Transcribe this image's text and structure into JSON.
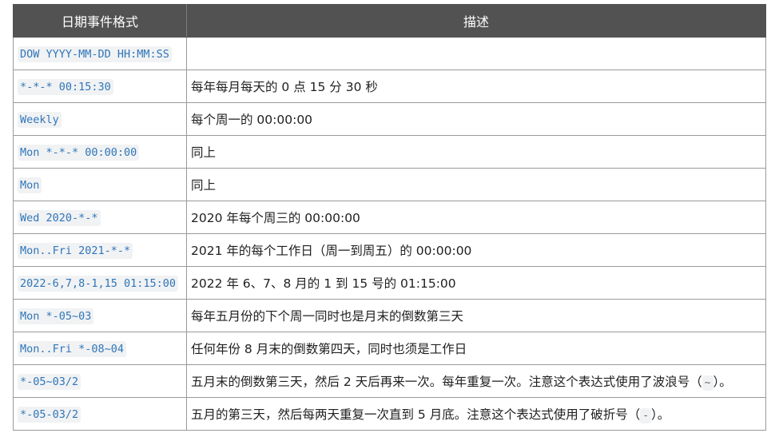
{
  "table": {
    "headers": [
      "日期事件格式",
      "描述"
    ],
    "rows": [
      {
        "format": "DOW YYYY-MM-DD HH:MM:SS",
        "desc": ""
      },
      {
        "format": "*-*-* 00:15:30",
        "desc": "每年每月每天的 0 点 15 分 30 秒"
      },
      {
        "format": "Weekly",
        "desc": "每个周一的 00:00:00"
      },
      {
        "format": "Mon *-*-* 00:00:00",
        "desc": "同上"
      },
      {
        "format": "Mon",
        "desc": "同上"
      },
      {
        "format": "Wed 2020-*-*",
        "desc": "2020 年每个周三的 00:00:00"
      },
      {
        "format": "Mon..Fri 2021-*-*",
        "desc": "2021 年的每个工作日（周一到周五）的 00:00:00"
      },
      {
        "format": "2022-6,7,8-1,15 01:15:00",
        "desc": "2022 年 6、7、8 月的 1 到 15 号的 01:15:00"
      },
      {
        "format": "Mon *-05~03",
        "desc": "每年五月份的下个周一同时也是月末的倒数第三天"
      },
      {
        "format": "Mon..Fri *-08~04",
        "desc": "任何年份 8 月末的倒数第四天，同时也须是工作日"
      },
      {
        "format": "*-05~03/2",
        "desc_before": "五月末的倒数第三天，然后 2 天后再来一次。每年重复一次。注意这个表达式使用了波浪号（",
        "desc_code": "~",
        "desc_after": "）。"
      },
      {
        "format": "*-05-03/2",
        "desc_before": "五月的第三天，然后每两天重复一次直到 5 月底。注意这个表达式使用了破折号（",
        "desc_code": "-",
        "desc_after": "）。"
      }
    ]
  }
}
